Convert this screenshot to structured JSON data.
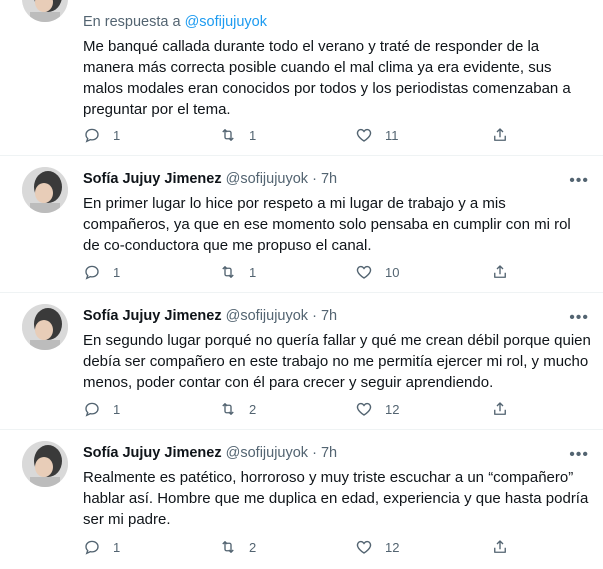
{
  "tweets": [
    {
      "reply_prefix": "En respuesta a",
      "reply_handle": "@sofijujuyok",
      "text": "Me banqué callada durante todo el verano y traté de responder de la manera más correcta posible cuando el mal clima ya era evidente, sus malos modales eran conocidos por todos y los periodistas comenzaban a preguntar por el tema.",
      "replies": "1",
      "retweets": "1",
      "likes": "11"
    },
    {
      "name": "Sofía Jujuy Jimenez",
      "handle": "@sofijujuyok",
      "time": "· 7h",
      "text": "En primer lugar lo hice por respeto a mi lugar de trabajo y a mis compañeros, ya que en ese momento solo pensaba en cumplir con mi rol de co-conductora que me propuso el canal.",
      "replies": "1",
      "retweets": "1",
      "likes": "10"
    },
    {
      "name": "Sofía Jujuy Jimenez",
      "handle": "@sofijujuyok",
      "time": "· 7h",
      "text": "En segundo lugar porqué no quería fallar y qué me crean débil porque quien debía ser compañero en este trabajo no me permitía ejercer mi rol, y mucho menos, poder contar con él para crecer y seguir aprendiendo.",
      "replies": "1",
      "retweets": "2",
      "likes": "12"
    },
    {
      "name": "Sofía Jujuy Jimenez",
      "handle": "@sofijujuyok",
      "time": "· 7h",
      "text": "Realmente es patético, horroroso y muy triste escuchar a un “compañero” hablar así. Hombre que me duplica en edad, experiencia y que hasta podría ser mi padre.",
      "replies": "1",
      "retweets": "2",
      "likes": "12"
    }
  ],
  "more_glyph": "•••"
}
